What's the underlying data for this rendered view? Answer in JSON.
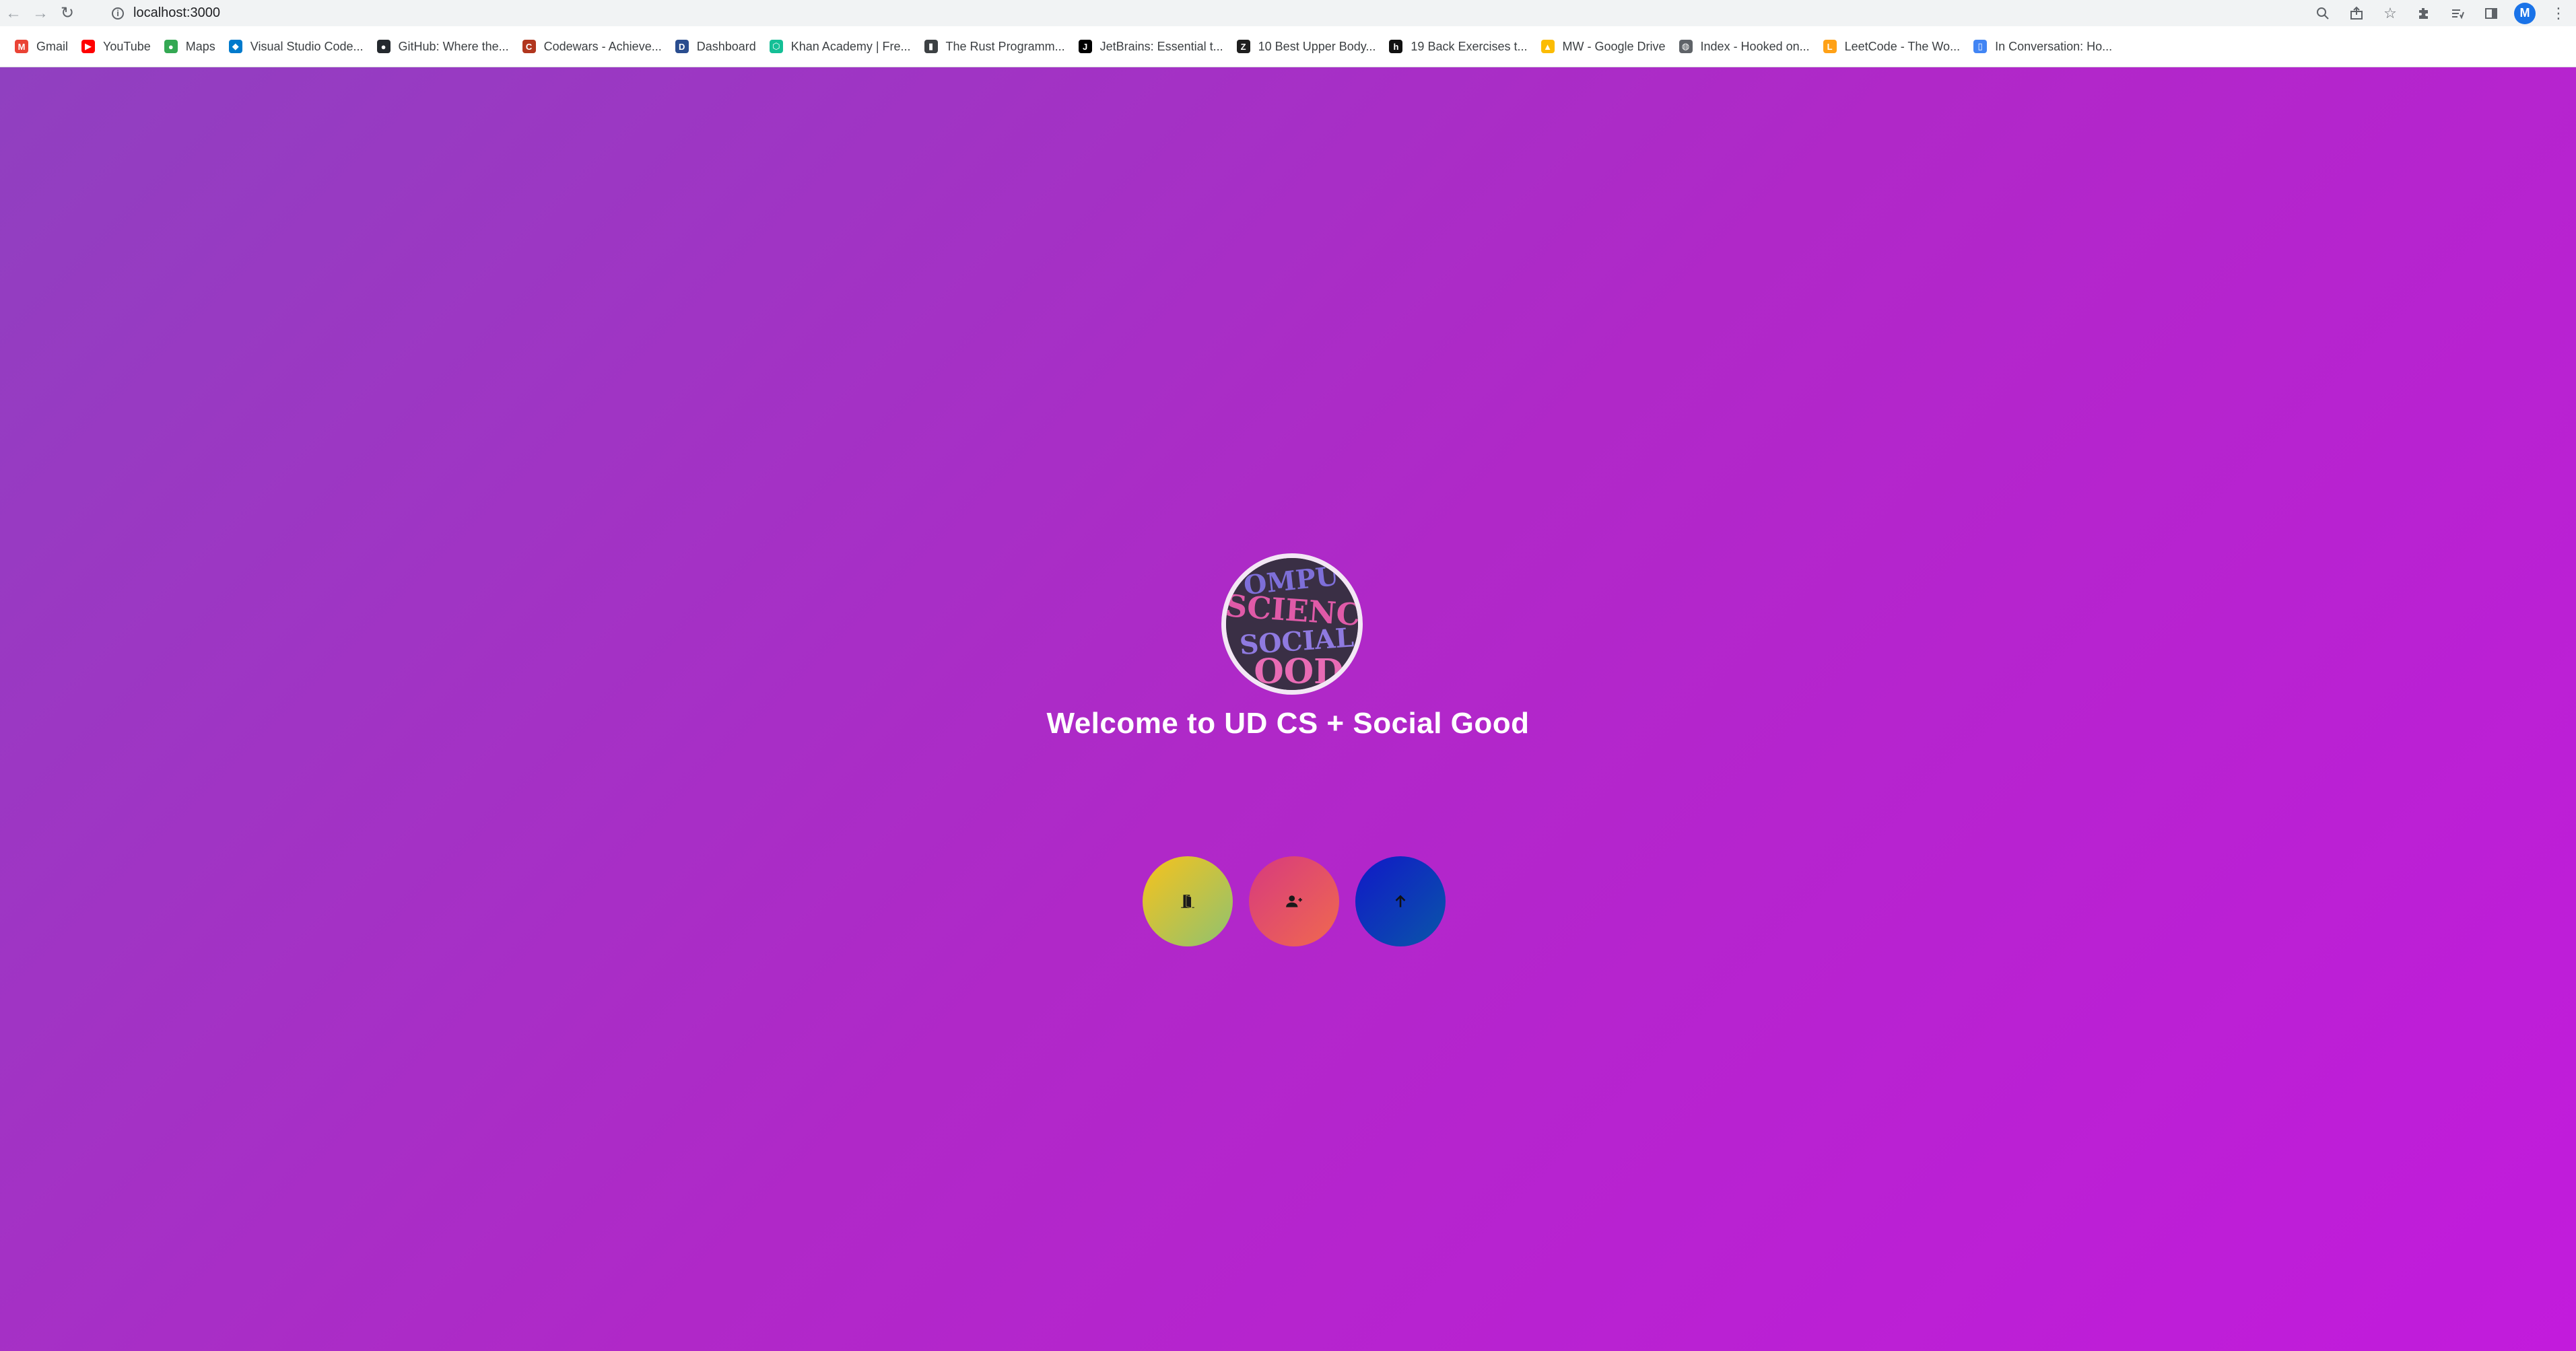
{
  "browser": {
    "url": "localhost:3000",
    "profile_initial": "M",
    "bookmarks": [
      {
        "label": "Gmail",
        "icon": "gmail-icon",
        "color": "#ea4335",
        "glyph": "M"
      },
      {
        "label": "YouTube",
        "icon": "youtube-icon",
        "color": "#ff0000",
        "glyph": "▶"
      },
      {
        "label": "Maps",
        "icon": "maps-icon",
        "color": "#34a853",
        "glyph": "●"
      },
      {
        "label": "Visual Studio Code...",
        "icon": "vscode-icon",
        "color": "#007acc",
        "glyph": "◆"
      },
      {
        "label": "GitHub: Where the...",
        "icon": "github-icon",
        "color": "#24292e",
        "glyph": "●"
      },
      {
        "label": "Codewars - Achieve...",
        "icon": "codewars-icon",
        "color": "#b1361e",
        "glyph": "C"
      },
      {
        "label": "Dashboard",
        "icon": "dashboard-icon",
        "color": "#2a4d8f",
        "glyph": "D"
      },
      {
        "label": "Khan Academy | Fre...",
        "icon": "khan-academy-icon",
        "color": "#14bf96",
        "glyph": "⬡"
      },
      {
        "label": "The Rust Programm...",
        "icon": "book-icon",
        "color": "#3c4043",
        "glyph": "▮"
      },
      {
        "label": "JetBrains: Essential t...",
        "icon": "jetbrains-icon",
        "color": "#000000",
        "glyph": "J"
      },
      {
        "label": "10 Best Upper Body...",
        "icon": "article-icon",
        "color": "#1f1f1f",
        "glyph": "Z"
      },
      {
        "label": "19 Back Exercises t...",
        "icon": "healthline-icon",
        "color": "#111111",
        "glyph": "h"
      },
      {
        "label": "MW - Google Drive",
        "icon": "google-drive-icon",
        "color": "#fbbc04",
        "glyph": "▲"
      },
      {
        "label": "Index - Hooked on...",
        "icon": "globe-icon",
        "color": "#5f6368",
        "glyph": "◍"
      },
      {
        "label": "LeetCode - The Wo...",
        "icon": "leetcode-icon",
        "color": "#ffa116",
        "glyph": "L"
      },
      {
        "label": "In Conversation: Ho...",
        "icon": "bookmark-icon",
        "color": "#4285f4",
        "glyph": "▯"
      }
    ]
  },
  "page": {
    "title": "Welcome to UD CS + Social Good",
    "logo_lines": [
      "OMPU",
      "SCIENC",
      "SOCIAL",
      "OOD"
    ],
    "buttons": [
      {
        "name": "login-button",
        "icon": "door-enter-icon"
      },
      {
        "name": "register-button",
        "icon": "user-plus-icon"
      },
      {
        "name": "upload-button",
        "icon": "arrow-up-icon"
      }
    ]
  },
  "colors": {
    "gradient_start": "#9040c0",
    "gradient_end": "#c21bdc",
    "login_gradient": [
      "#f7c21c",
      "#8fc270"
    ],
    "register_gradient": [
      "#d73a7e",
      "#f0694f"
    ],
    "upload_gradient": [
      "#1018c8",
      "#0a56a8"
    ]
  }
}
